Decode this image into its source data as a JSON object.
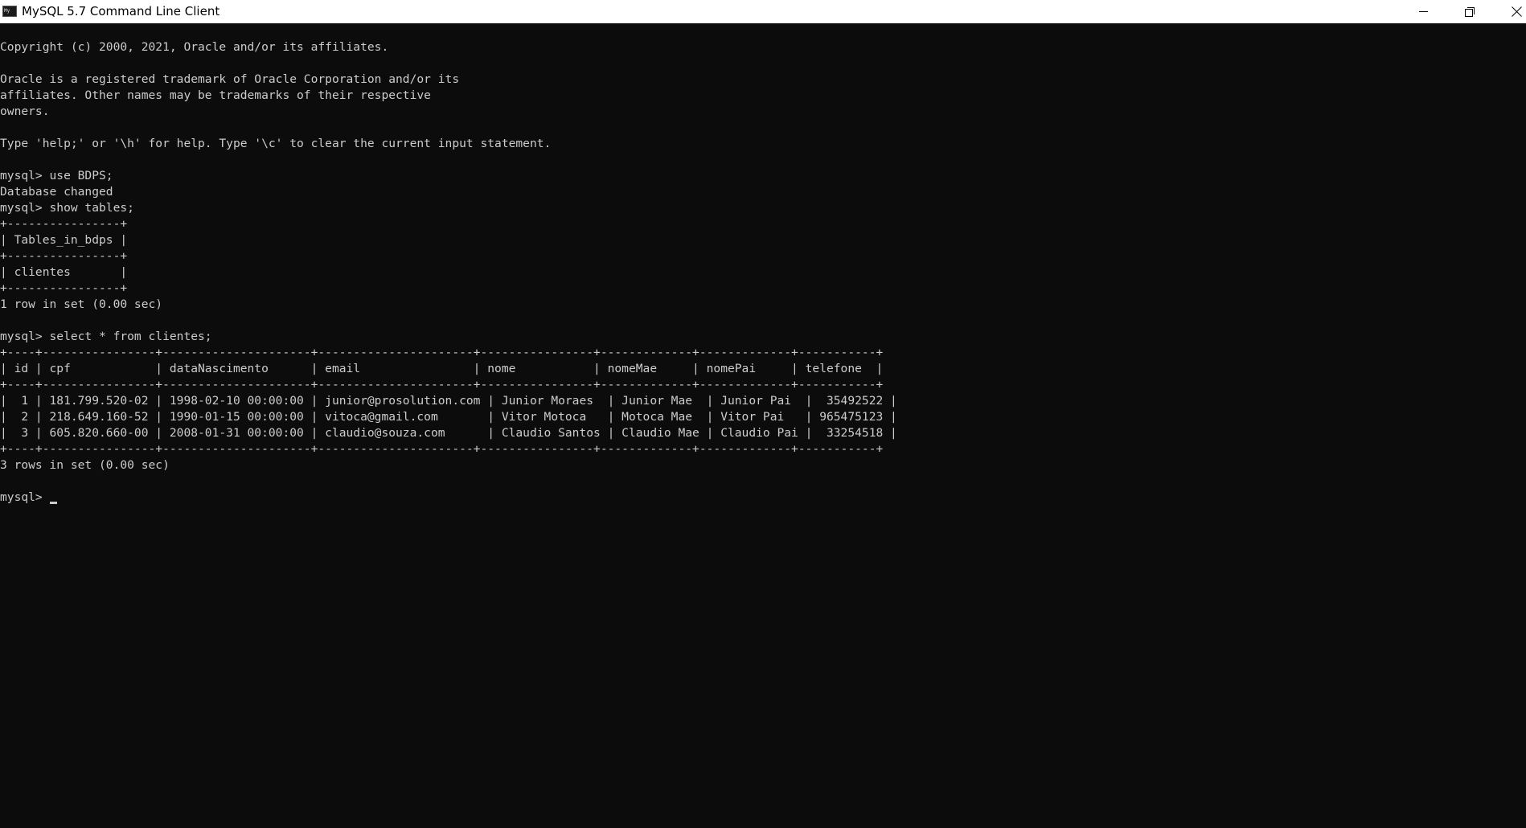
{
  "window": {
    "title": "MySQL 5.7 Command Line Client",
    "icon": "mysql-console-icon",
    "controls": {
      "minimize_icon": "minimize-icon",
      "maximize_icon": "restore-icon",
      "close_icon": "close-icon"
    }
  },
  "colors": {
    "background": "#0c0c0c",
    "text": "#cccccc",
    "titlebar": "#ffffff"
  },
  "console": {
    "lines": [
      "Copyright (c) 2000, 2021, Oracle and/or its affiliates.",
      "",
      "Oracle is a registered trademark of Oracle Corporation and/or its",
      "affiliates. Other names may be trademarks of their respective",
      "owners.",
      "",
      "Type 'help;' or '\\h' for help. Type '\\c' to clear the current input statement.",
      "",
      "mysql> use BDPS;",
      "Database changed",
      "mysql> show tables;",
      "+----------------+",
      "| Tables_in_bdps |",
      "+----------------+",
      "| clientes       |",
      "+----------------+",
      "1 row in set (0.00 sec)",
      "",
      "mysql> select * from clientes;",
      "+----+----------------+---------------------+----------------------+----------------+-------------+-------------+-----------+",
      "| id | cpf            | dataNascimento      | email                | nome           | nomeMae     | nomePai     | telefone  |",
      "+----+----------------+---------------------+----------------------+----------------+-------------+-------------+-----------+",
      "|  1 | 181.799.520-02 | 1998-02-10 00:00:00 | junior@prosolution.com | Junior Moraes  | Junior Mae  | Junior Pai  |  35492522 |",
      "|  2 | 218.649.160-52 | 1990-01-15 00:00:00 | vitoca@gmail.com       | Vitor Motoca   | Motoca Mae  | Vitor Pai   | 965475123 |",
      "|  3 | 605.820.660-00 | 2008-01-31 00:00:00 | claudio@souza.com      | Claudio Santos | Claudio Mae | Claudio Pai |  33254518 |",
      "+----+----------------+---------------------+----------------------+----------------+-------------+-------------+-----------+",
      "3 rows in set (0.00 sec)",
      ""
    ],
    "prompt": "mysql> "
  }
}
